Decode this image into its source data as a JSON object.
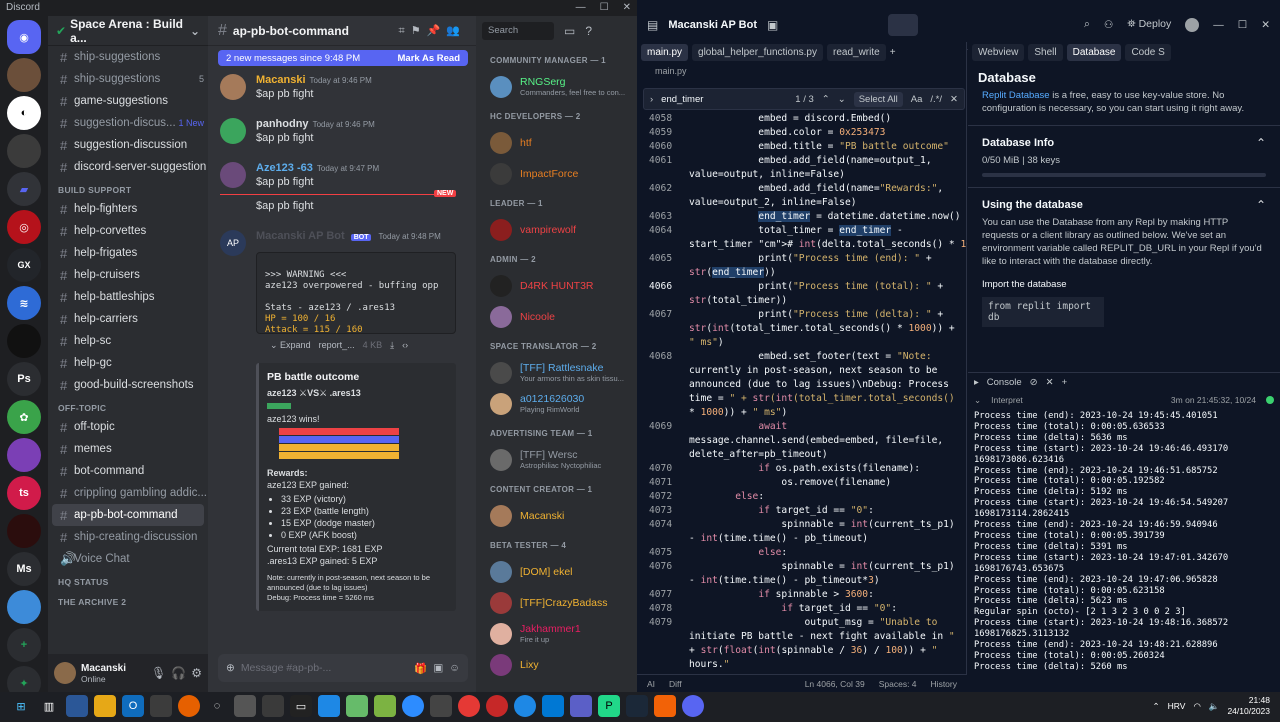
{
  "discord": {
    "app_title": "Discord",
    "guild_name": "Space Arena : Build a...",
    "channel_groups": [
      {
        "items": [
          {
            "label": "ship-suggestions",
            "badge": ""
          },
          {
            "label": "ship-suggestions",
            "badge": "5"
          },
          {
            "label": "game-suggestions",
            "badge": ""
          },
          {
            "label": "suggestion-discus...",
            "badge": "1 New"
          },
          {
            "label": "suggestion-discussion",
            "badge": ""
          },
          {
            "label": "discord-server-suggestion",
            "badge": ""
          }
        ]
      },
      {
        "category": "BUILD SUPPORT",
        "items": [
          {
            "label": "help-fighters"
          },
          {
            "label": "help-corvettes"
          },
          {
            "label": "help-frigates"
          },
          {
            "label": "help-cruisers"
          },
          {
            "label": "help-battleships"
          },
          {
            "label": "help-carriers"
          },
          {
            "label": "help-sc"
          },
          {
            "label": "help-gc"
          },
          {
            "label": "good-build-screenshots"
          }
        ]
      },
      {
        "category": "OFF-TOPIC",
        "items": [
          {
            "label": "off-topic"
          },
          {
            "label": "memes"
          },
          {
            "label": "bot-command"
          },
          {
            "label": "crippling gambling addic..."
          },
          {
            "label": "ap-pb-bot-command"
          },
          {
            "label": "ship-creating-discussion"
          },
          {
            "label": "Voice Chat"
          }
        ]
      }
    ],
    "categories_collapsed": [
      "HQ STATUS",
      "THE ARCHIVE 2"
    ],
    "user": {
      "name": "Macanski",
      "status": "Online"
    },
    "channel_title": "ap-pb-bot-command",
    "new_messages": "2 new messages since 9:48 PM",
    "mark_as_read": "Mark As Read",
    "messages": [
      {
        "author": "Macanski",
        "time": "Today at 9:46 PM",
        "text": "$ap pb fight",
        "color": "#f0b232"
      },
      {
        "author": "panhodny",
        "time": "Today at 9:46 PM",
        "text": "$ap pb fight",
        "color": "#dbdee1"
      },
      {
        "author": "Aze123 -63",
        "time": "Today at 9:47 PM",
        "text": "$ap pb fight",
        "color": "#5dadec"
      }
    ],
    "followup_text": "$ap pb fight",
    "new_label": "NEW",
    "bot": {
      "author": "Macanski AP Bot",
      "tag": "BOT",
      "time": "Today at 9:48 PM",
      "code_lines": [
        ">>> WARNING <<<",
        "aze123 overpowered - buffing opp",
        "",
        "Stats - aze123 / .ares13",
        "HP = 100 / 16",
        "Attack = 115 / 160"
      ],
      "expand": "Expand",
      "file": "report_...",
      "file_size": "4 KB",
      "embed_title": "PB battle outcome",
      "vs_line": "aze123 ⚔VS⚔ .ares13",
      "wins": "aze123 wins!",
      "rewards_title": "Rewards:",
      "gained": "aze123 EXP gained:",
      "rewards": [
        "33 EXP (victory)",
        "23 EXP (battle length)",
        "15 EXP (dodge master)",
        "0 EXP (AFK boost)"
      ],
      "total_exp": "Current total EXP: 1681 EXP",
      "ares_exp": ".ares13 EXP gained: 5 EXP",
      "note": "Note: currently in post-season, next season to be announced (due to lag issues)",
      "debug": "Debug: Process time = 5260 ms"
    },
    "composer_placeholder": "Message #ap-pb-...",
    "search_placeholder": "Search",
    "members": [
      {
        "role": "COMMUNITY MANAGER — 1",
        "list": [
          {
            "name": "RNGSerg",
            "status": "Commanders, feel free to con...",
            "color": "#57f287"
          }
        ]
      },
      {
        "role": "HC DEVELOPERS — 2",
        "list": [
          {
            "name": "htf",
            "status": "",
            "color": "#e67e22"
          },
          {
            "name": "ImpactForce",
            "status": "",
            "color": "#e67e22"
          }
        ]
      },
      {
        "role": "LEADER — 1",
        "list": [
          {
            "name": "vampirewolf",
            "status": "",
            "color": "#ed4245"
          }
        ]
      },
      {
        "role": "ADMIN — 2",
        "list": [
          {
            "name": "D4RK HUNT3R",
            "status": "",
            "color": "#ed4245"
          },
          {
            "name": "Nicoole",
            "status": "",
            "color": "#ed4245"
          }
        ]
      },
      {
        "role": "SPACE TRANSLATOR — 2",
        "list": [
          {
            "name": "[TFF] Rattlesnake",
            "status": "Your armors thin as skin tissu...",
            "color": "#5dadec"
          },
          {
            "name": "a0121626030",
            "status": "Playing RimWorld",
            "color": "#5dadec"
          }
        ]
      },
      {
        "role": "ADVERTISING TEAM — 1",
        "list": [
          {
            "name": "[TFF] Wersc",
            "status": "Astrophiliac Nyctophiliac",
            "color": "#949ba4"
          }
        ]
      },
      {
        "role": "CONTENT CREATOR — 1",
        "list": [
          {
            "name": "Macanski",
            "status": "",
            "color": "#f0b232"
          }
        ]
      },
      {
        "role": "BETA TESTER — 4",
        "list": [
          {
            "name": "[DOM] ekel",
            "status": "",
            "color": "#f0b232"
          },
          {
            "name": "[TFF]CrazyBadass",
            "status": "",
            "color": "#f0b232"
          },
          {
            "name": "Jakhammer1",
            "status": "Fire it up",
            "color": "#e91e63"
          },
          {
            "name": "Lixy",
            "status": "",
            "color": "#f0b232"
          }
        ]
      }
    ]
  },
  "replit": {
    "title": "Macanski AP Bot",
    "deploy": "Deploy",
    "editor_tabs": [
      "main.py",
      "global_helper_functions.py",
      "read_write"
    ],
    "breadcrumb": "main.py",
    "find_value": "end_timer",
    "find_count": "1 / 3",
    "select_all": "Select All",
    "right_tabs": [
      "Webview",
      "Shell",
      "Database",
      "Code S"
    ],
    "db": {
      "title": "Database",
      "intro_link": "Replit Database",
      "intro_rest": " is a free, easy to use key-value store. No configuration is necessary, so you can start using it right away.",
      "info_title": "Database Info",
      "usage": "0/50 MiB | 38 keys",
      "using_title": "Using the database",
      "using_text": "You can use the Database from any Repl by making HTTP requests or a client library as outlined below. We've set an environment variable called REPLIT_DB_URL in your Repl if you'd like to interact with the database directly.",
      "import_label": "Import the database",
      "import_code": "from replit import db"
    },
    "console": {
      "title": "Console",
      "sub_left": "Interpret",
      "sub_right": "3m on 21:45:32, 10/24",
      "lines": [
        "Process time (end): 2023-10-24 19:45:45.401051",
        "Process time (total): 0:00:05.636533",
        "Process time (delta): 5636 ms",
        "Process time (start): 2023-10-24 19:46:46.493170",
        "1698173086.623416",
        "Process time (end): 2023-10-24 19:46:51.685752",
        "Process time (total): 0:00:05.192582",
        "Process time (delta): 5192 ms",
        "Process time (start): 2023-10-24 19:46:54.549207",
        "1698173114.2862415",
        "Process time (end): 2023-10-24 19:46:59.940946",
        "Process time (total): 0:00:05.391739",
        "Process time (delta): 5391 ms",
        "Process time (start): 2023-10-24 19:47:01.342670",
        "1698176743.653675",
        "Process time (end): 2023-10-24 19:47:06.965828",
        "Process time (total): 0:00:05.623158",
        "Process time (delta): 5623 ms",
        "Regular spin (octo)- [2 1 3 2 3 0 0 2 3]",
        "Process time (start): 2023-10-24 19:48:16.368572",
        "1698176825.3113132",
        "Process time (end): 2023-10-24 19:48:21.628896",
        "Process time (total): 0:00:05.260324",
        "Process time (delta): 5260 ms"
      ]
    },
    "status": {
      "left": "AI",
      "diff": "Diff",
      "pos": "Ln 4066, Col 39",
      "spaces": "Spaces: 4",
      "history": "History"
    },
    "code": [
      {
        "n": "4058",
        "t": "            embed = discord.Embed()"
      },
      {
        "n": "4059",
        "t": "            embed.color = 0x253473"
      },
      {
        "n": "4060",
        "t": "            embed.title = \"PB battle outcome\""
      },
      {
        "n": "4061",
        "t": "            embed.add_field(name=output_1,"
      },
      {
        "n": "",
        "t": "value=output, inline=False)"
      },
      {
        "n": "4062",
        "t": "            embed.add_field(name=\"Rewards:\","
      },
      {
        "n": "",
        "t": "value=output_2, inline=False)"
      },
      {
        "n": "4063",
        "t": "            end_timer = datetime.datetime.now()"
      },
      {
        "n": "4064",
        "t": "            total_timer = end_timer -"
      },
      {
        "n": "",
        "t": "start_timer # int(delta.total_seconds() * 1000)"
      },
      {
        "n": "4065",
        "t": "            print(\"Process time (end): \" +"
      },
      {
        "n": "",
        "t": "str(end_timer))"
      },
      {
        "n": "4066",
        "t": "            print(\"Process time (total): \" +"
      },
      {
        "n": "",
        "t": "str(total_timer))"
      },
      {
        "n": "4067",
        "t": "            print(\"Process time (delta): \" +"
      },
      {
        "n": "",
        "t": "str(int(total_timer.total_seconds() * 1000)) +"
      },
      {
        "n": "",
        "t": "\" ms\")"
      },
      {
        "n": "4068",
        "t": "            embed.set_footer(text = \"Note:"
      },
      {
        "n": "",
        "t": "currently in post-season, next season to be"
      },
      {
        "n": "",
        "t": "announced (due to lag issues)\\nDebug: Process"
      },
      {
        "n": "",
        "t": "time = \" + str(int(total_timer.total_seconds()"
      },
      {
        "n": "",
        "t": "* 1000)) + \" ms\")"
      },
      {
        "n": "4069",
        "t": "            await"
      },
      {
        "n": "",
        "t": "message.channel.send(embed=embed, file=file,"
      },
      {
        "n": "",
        "t": "delete_after=pb_timeout)"
      },
      {
        "n": "4070",
        "t": "            if os.path.exists(filename):"
      },
      {
        "n": "4071",
        "t": "                os.remove(filename)"
      },
      {
        "n": "4072",
        "t": "        else:"
      },
      {
        "n": "4073",
        "t": "            if target_id == \"0\":"
      },
      {
        "n": "4074",
        "t": "                spinnable = int(current_ts_p1)"
      },
      {
        "n": "",
        "t": "- int(time.time() - pb_timeout)"
      },
      {
        "n": "4075",
        "t": "            else:"
      },
      {
        "n": "4076",
        "t": "                spinnable = int(current_ts_p1)"
      },
      {
        "n": "",
        "t": "- int(time.time() - pb_timeout*3)"
      },
      {
        "n": "4077",
        "t": "            if spinnable > 3600:"
      },
      {
        "n": "4078",
        "t": "                if target_id == \"0\":"
      },
      {
        "n": "4079",
        "t": "                    output_msg = \"Unable to"
      },
      {
        "n": "",
        "t": "initiate PB battle - next fight available in \""
      },
      {
        "n": "",
        "t": "+ str(float(int(spinnable / 36) / 100)) + \""
      },
      {
        "n": "",
        "t": "hours.\""
      }
    ]
  },
  "taskbar": {
    "lang": "HRV",
    "time": "21:48",
    "date": "24/10/2023"
  }
}
